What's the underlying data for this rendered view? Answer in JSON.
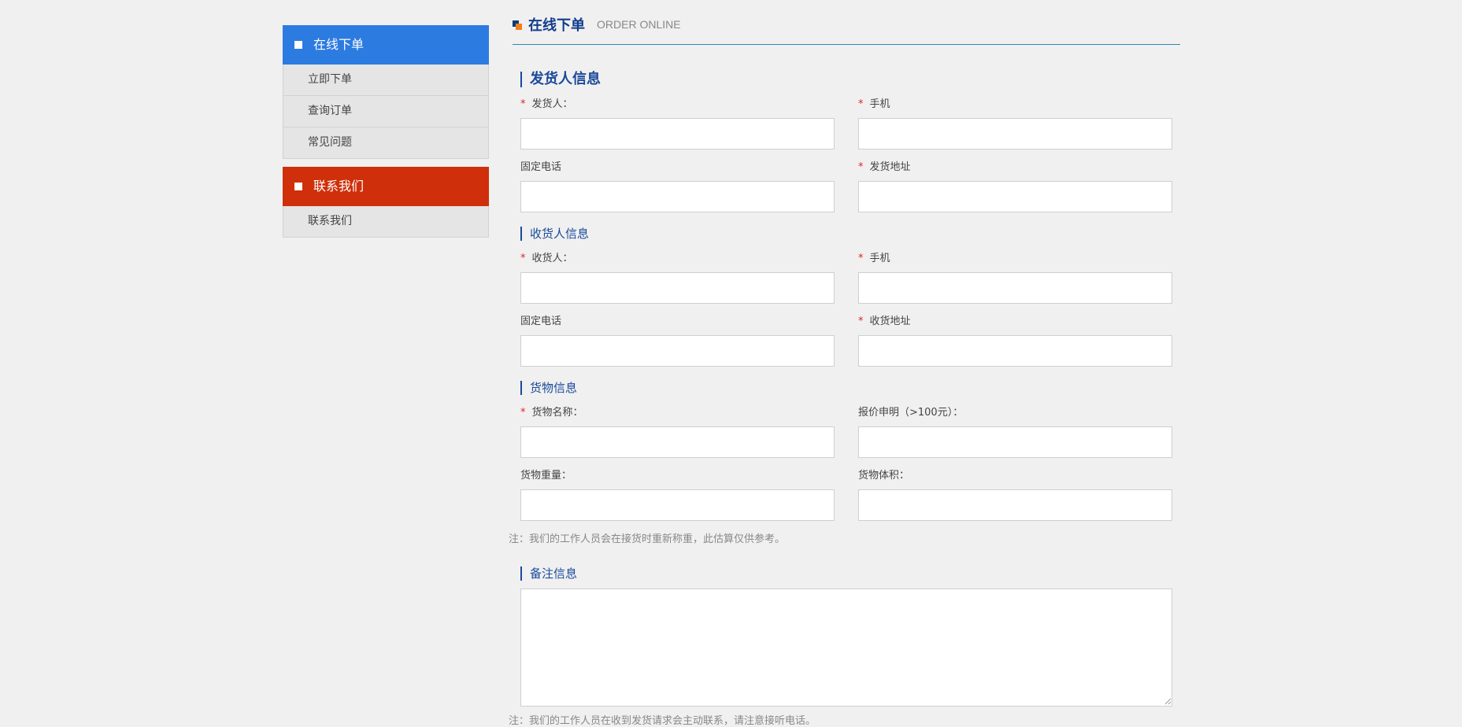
{
  "sidebar": {
    "order_section": {
      "title": "在线下单",
      "color": "#2c7be1"
    },
    "order_items": [
      "立即下单",
      "查询订单",
      "常见问题"
    ],
    "contact_section": {
      "title": "联系我们",
      "color": "#cf2f0a"
    },
    "contact_items": [
      "联系我们"
    ]
  },
  "header": {
    "title_cn": "在线下单",
    "title_en": "ORDER ONLINE"
  },
  "sender": {
    "heading": "发货人信息",
    "name_label": "发货人：",
    "phone_label": "手机",
    "tel_label": "固定电话",
    "address_label": "发货地址"
  },
  "receiver": {
    "heading": "收货人信息",
    "name_label": "收货人：",
    "phone_label": "手机",
    "tel_label": "固定电话",
    "address_label": "收货地址"
  },
  "goods": {
    "heading": "货物信息",
    "name_label": "货物名称：",
    "insured_label": "报价申明（>100元）：",
    "weight_label": "货物重量：",
    "volume_label": "货物体积：",
    "note": "注：我们的工作人员会在接货时重新称重，此估算仅供参考。"
  },
  "remarks": {
    "heading": "备注信息",
    "note": "注：我们的工作人员在收到发货请求会主动联系，请注意接听电话。"
  },
  "required_mark": "*"
}
